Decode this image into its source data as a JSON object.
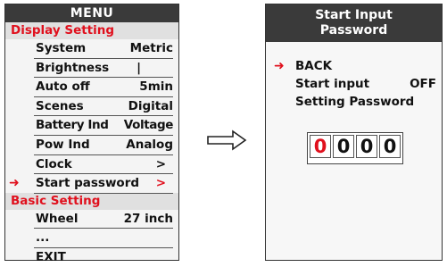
{
  "menu": {
    "title": "MENU",
    "display_section": "Display Setting",
    "display_items": [
      {
        "label": "System",
        "value": "Metric"
      },
      {
        "label": "Brightness",
        "value": "|"
      },
      {
        "label": "Auto off",
        "value": "5min"
      },
      {
        "label": "Scenes",
        "value": "Digital"
      },
      {
        "label": "Battery Ind",
        "value": "Voltage"
      },
      {
        "label": "Pow Ind",
        "value": "Analog"
      },
      {
        "label": "Clock",
        "value": ">"
      },
      {
        "label": "Start password",
        "value": ">"
      }
    ],
    "basic_section": "Basic Setting",
    "basic_items": [
      {
        "label": "Wheel",
        "value": "27 inch"
      },
      {
        "label": "...",
        "value": ""
      },
      {
        "label": "EXIT",
        "value": ""
      }
    ],
    "selector_arrow": "➜"
  },
  "flow_arrow": "⇨",
  "password": {
    "title_line1": "Start Input",
    "title_line2": "Password",
    "items": [
      {
        "label": "BACK",
        "value": ""
      },
      {
        "label": "Start input",
        "value": "OFF"
      },
      {
        "label": "Setting Password",
        "value": ""
      }
    ],
    "selector_arrow": "➜",
    "digits": [
      "0",
      "0",
      "0",
      "0"
    ],
    "active_digit_color": "#e0101d"
  },
  "colors": {
    "accent_red": "#e0101d",
    "title_bar": "#3a3a3a"
  }
}
